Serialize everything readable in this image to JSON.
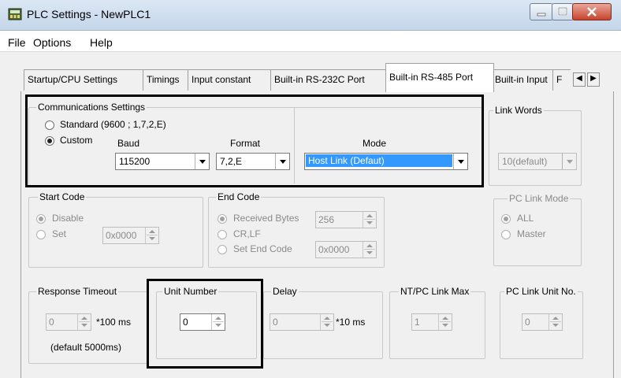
{
  "window": {
    "title": "PLC Settings - NewPLC1"
  },
  "menu": [
    "File",
    "Options",
    "Help"
  ],
  "tabs": [
    "Startup/CPU Settings",
    "Timings",
    "Input constant",
    "Built-in RS-232C Port",
    "Built-in RS-485 Port",
    "Built-in Input",
    "F"
  ],
  "comm": {
    "title": "Communications Settings",
    "standard_label": "Standard (9600 ; 1,7,2,E)",
    "custom_label": "Custom",
    "baud_label": "Baud",
    "baud_value": "115200",
    "format_label": "Format",
    "format_value": "7,2,E",
    "mode_label": "Mode",
    "mode_value": "Host Link (Defaut)"
  },
  "link_words": {
    "title": "Link Words",
    "value": "10(default)"
  },
  "start_code": {
    "title": "Start Code",
    "disable": "Disable",
    "set": "Set",
    "value": "0x0000"
  },
  "end_code": {
    "title": "End Code",
    "received": "Received Bytes",
    "received_value": "256",
    "crlf": "CR,LF",
    "set_end": "Set End Code",
    "set_end_value": "0x0000"
  },
  "pc_link_mode": {
    "title": "PC Link Mode",
    "all": "ALL",
    "master": "Master"
  },
  "response_timeout": {
    "title": "Response Timeout",
    "value": "0",
    "unit": "*100 ms",
    "note": "(default 5000ms)"
  },
  "unit_number": {
    "title": "Unit Number",
    "value": "0"
  },
  "delay": {
    "title": "Delay",
    "value": "0",
    "unit": "*10 ms"
  },
  "nt_pc_link_max": {
    "title": "NT/PC Link Max",
    "value": "1"
  },
  "pc_link_unit_no": {
    "title": "PC Link Unit No.",
    "value": "0"
  },
  "colors": {
    "selection": "#3399ff",
    "highlight_box": "#000000"
  }
}
